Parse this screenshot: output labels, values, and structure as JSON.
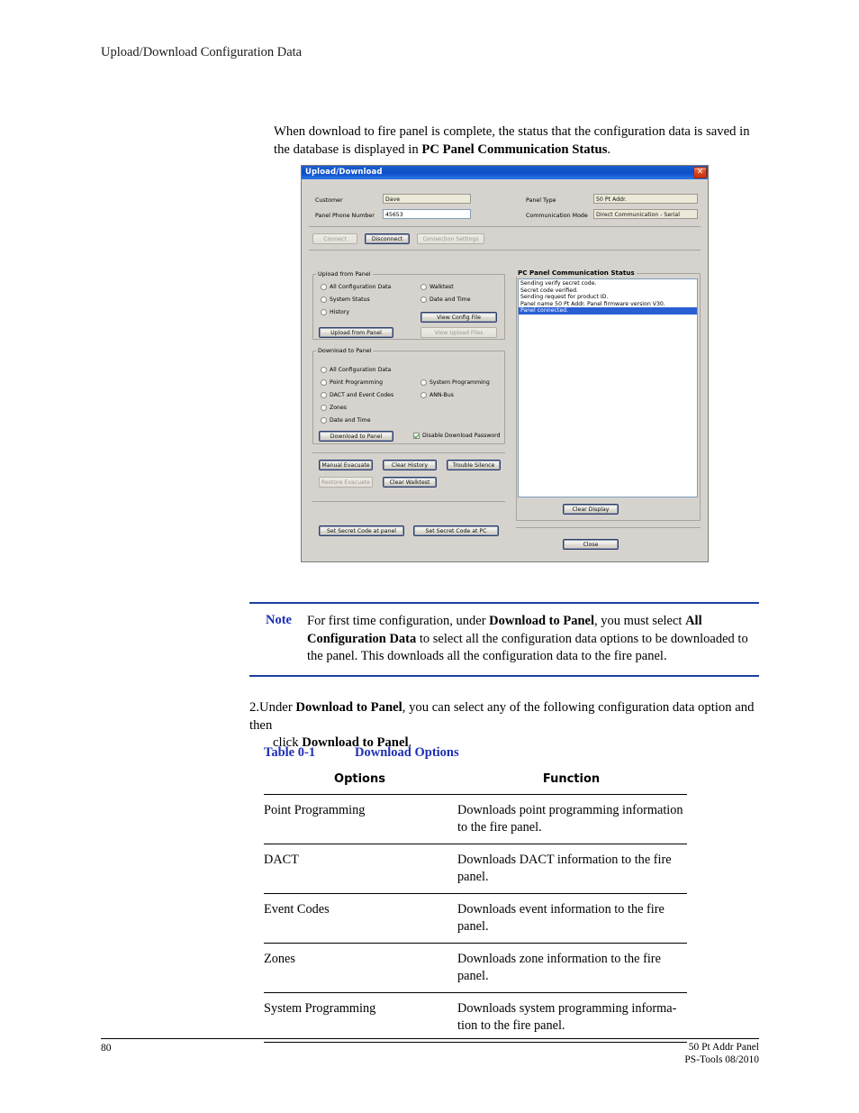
{
  "running_head": "Upload/Download Configuration Data",
  "intro": {
    "before": "When download to fire panel is complete, the status that the configuration data is saved in the database is displayed in ",
    "bold": "PC Panel Communication Status",
    "after": "."
  },
  "dialog": {
    "title": "Upload/Download",
    "close_icon": "close-icon",
    "fields": {
      "customer_label": "Customer",
      "customer_value": "Dave",
      "phone_label": "Panel Phone Number",
      "phone_value": "45653",
      "panel_type_label": "Panel Type",
      "panel_type_value": "50 Pt Addr.",
      "comm_mode_label": "Communication Mode",
      "comm_mode_value": "Direct Communication - Serial"
    },
    "connection_buttons": [
      {
        "label": "Connect",
        "state": "disabled"
      },
      {
        "label": "Disconnect",
        "state": "focused"
      },
      {
        "label": "Connection Settings",
        "state": "disabled"
      }
    ],
    "upload_group": {
      "title": "Upload from Panel",
      "radios_left": [
        "All Configuration Data",
        "System Status",
        "History"
      ],
      "radios_right": [
        "Walktest",
        "Date and Time"
      ],
      "view_config_button": "View Config File",
      "upload_button": "Upload from Panel",
      "view_upload_button": "View Upload Files"
    },
    "download_group": {
      "title": "Download to Panel",
      "radios_left": [
        "All Configuration Data",
        "Point Programming",
        "DACT and Event Codes",
        "Zones",
        "Date and Time"
      ],
      "radios_right": [
        "System Programming",
        "ANN-Bus"
      ],
      "download_button": "Download to Panel",
      "checkbox_label": "Disable Download Password",
      "checkbox_checked": true
    },
    "action_buttons": [
      {
        "label": "Manual Evacuate",
        "state": "normal"
      },
      {
        "label": "Clear History",
        "state": "normal"
      },
      {
        "label": "Trouble Silence",
        "state": "normal"
      },
      {
        "label": "Restore Evacuate",
        "state": "disabled"
      },
      {
        "label": "Clear Walktest",
        "state": "normal"
      }
    ],
    "secret_buttons": [
      {
        "label": "Set Secret Code at panel"
      },
      {
        "label": "Set Secret Code at PC"
      }
    ],
    "status": {
      "title": "PC Panel Communication Status",
      "lines": [
        {
          "text": "Sending verify secret code.",
          "selected": false
        },
        {
          "text": "Secret code verified.",
          "selected": false
        },
        {
          "text": "Sending request for product ID.",
          "selected": false
        },
        {
          "text": "Panel name 50 Pt Addr. Panel firmware version V30.",
          "selected": false
        },
        {
          "text": "Panel connected.",
          "selected": true
        }
      ],
      "clear_button": "Clear Display"
    },
    "close_button": "Close"
  },
  "note": {
    "label": "Note",
    "p1": "For first time configuration, under ",
    "b1": "Download to Panel",
    "p2": ", you must select ",
    "b2": "All Configuration Data",
    "p3": " to select all the configuration data options to be downloaded to the panel. This downloads all the configuration data to the fire panel."
  },
  "step2": {
    "number": "2.",
    "p1": "Under ",
    "b1": "Download to Panel",
    "p2": ", you can select any of the following configuration data option and then",
    "l2_p1": "click ",
    "l2_b1": "Download to Panel",
    "l2_p2": "."
  },
  "table": {
    "caption_number": "Table 0-1",
    "caption_title": "Download Options",
    "headers": [
      "Options",
      "Function"
    ],
    "rows": [
      {
        "option": "Point Programming",
        "function": "Downloads point programming information to the fire panel."
      },
      {
        "option": "DACT",
        "function": "Downloads DACT information to the fire panel."
      },
      {
        "option": "Event Codes",
        "function": "Downloads event information to the fire panel."
      },
      {
        "option": "Zones",
        "function": "Downloads zone information to the fire panel."
      },
      {
        "option": "System Programming",
        "function": "Downloads system programming informa-tion to the fire panel."
      }
    ]
  },
  "footer": {
    "page_number": "80",
    "right_line1": "50 Pt Addr Panel",
    "right_line2": "PS-Tools 08/2010"
  },
  "colors": {
    "accent_blue": "#1d2fb5",
    "titlebar_blue": "#0c4fc4",
    "dialog_face": "#d6d3ce",
    "selection_blue": "#2a5fd4"
  }
}
